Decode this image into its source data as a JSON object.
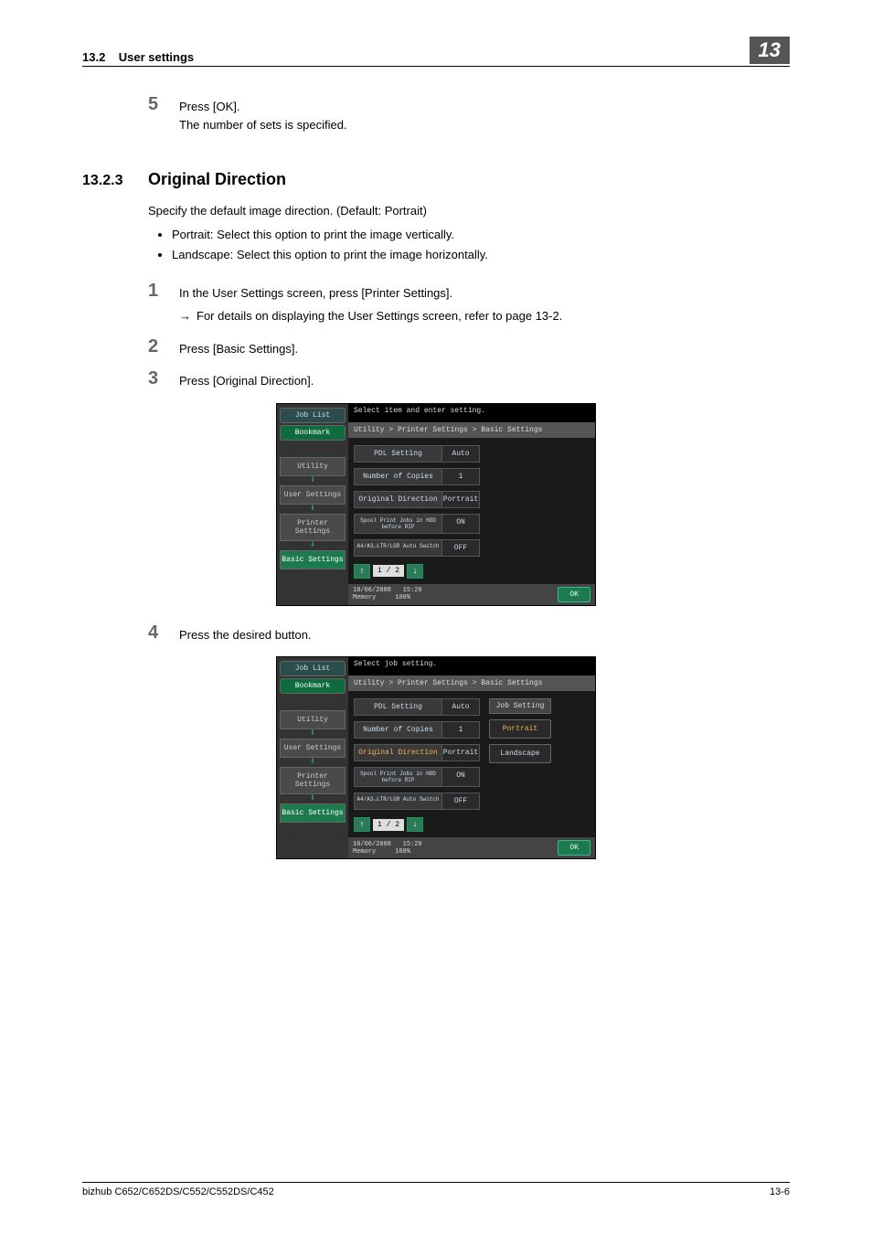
{
  "header": {
    "section_number": "13.2",
    "section_title": "User settings",
    "chapter": "13"
  },
  "step5": {
    "num": "5",
    "line1": "Press [OK].",
    "line2": "The number of sets is specified."
  },
  "section": {
    "number": "13.2.3",
    "title": "Original Direction"
  },
  "intro": "Specify the default image direction. (Default: Portrait)",
  "bullets": [
    "Portrait: Select this option to print the image vertically.",
    "Landscape: Select this option to print the image horizontally."
  ],
  "steps": {
    "s1": {
      "num": "1",
      "text": "In the User Settings screen, press [Printer Settings].",
      "sub": "For details on displaying the User Settings screen, refer to page 13-2."
    },
    "s2": {
      "num": "2",
      "text": "Press [Basic Settings]."
    },
    "s3": {
      "num": "3",
      "text": "Press [Original Direction]."
    },
    "s4": {
      "num": "4",
      "text": "Press the desired button."
    }
  },
  "screen1": {
    "joblist": "Job List",
    "bookmark": "Bookmark",
    "utility": "Utility",
    "usersettings": "User Settings",
    "printersettings": "Printer Settings",
    "basicsettings": "Basic Settings",
    "msg": "Select item and enter setting.",
    "breadcrumb": "Utility > Printer Settings > Basic Settings",
    "items": [
      {
        "label": "PDL Setting",
        "val": "Auto"
      },
      {
        "label": "Number of Copies",
        "val": "1"
      },
      {
        "label": "Original Direction",
        "val": "Portrait"
      },
      {
        "label": "Spool Print Jobs in HDD before RIP",
        "val": "ON"
      },
      {
        "label": "A4/A3↔LTR/LGR Auto Switch",
        "val": "OFF"
      }
    ],
    "pager": "1 / 2",
    "date": "10/06/2008",
    "time": "15:20",
    "mem": "Memory",
    "mempct": "100%",
    "ok": "OK"
  },
  "screen2": {
    "msg": "Select job setting.",
    "jobset_hdr": "Job Setting",
    "portrait": "Portrait",
    "landscape": "Landscape"
  },
  "footer": {
    "left": "bizhub C652/C652DS/C552/C552DS/C452",
    "right": "13-6"
  }
}
